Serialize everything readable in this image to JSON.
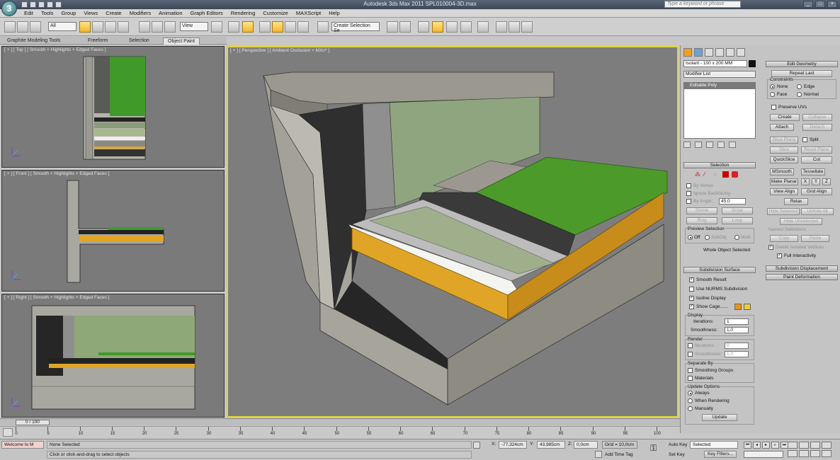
{
  "window": {
    "title": "Autodesk 3ds Max  2011     SPL010004-3D.max",
    "search_placeholder": "Type a keyword or phrase",
    "app_logo_letter": "3"
  },
  "menu": [
    "Edit",
    "Tools",
    "Group",
    "Views",
    "Create",
    "Modifiers",
    "Animation",
    "Graph Editors",
    "Rendering",
    "Customize",
    "MAXScript",
    "Help"
  ],
  "toolbar": {
    "selection_filter": "All",
    "ref_coord": "View",
    "named_selection_placeholder": "Create Selection Se"
  },
  "ribbon": {
    "tabs": [
      "Graphite Modeling Tools",
      "Freeform",
      "Selection",
      "Object Paint"
    ],
    "active_tab": "Object Paint"
  },
  "viewports": {
    "top": "[ + ] [ Top ] [ Smooth + Highlights + Edged Faces ]",
    "front": "[ + ] [ Front ] [ Smooth + Highlights + Edged Faces ]",
    "right": "[ + ] [ Right ] [ Smooth + Highlights + Edged Faces ]",
    "perspective": "[ + ] [ Perspective ] [ Ambient Occlusion + MXn* ]"
  },
  "command_panel": {
    "object_name": "Isolant - 100 x 200 MM",
    "modifier_list": "Modifier List",
    "stack_item": "Editable Poly",
    "edit_geometry": {
      "title": "Edit Geometry",
      "repeat_last": "Repeat Last",
      "constraints": "Constraints",
      "none": "None",
      "edge": "Edge",
      "face": "Face",
      "normal": "Normal",
      "preserve_uvs": "Preserve UVs",
      "create": "Create",
      "collapse": "Collapse",
      "attach": "Attach",
      "detach": "Detach",
      "slice_plane": "Slice Plane",
      "split": "Split",
      "slice": "Slice",
      "reset_plane": "Reset Plane",
      "quickslice": "QuickSlice",
      "cut": "Cut",
      "msmooth": "MSmooth",
      "tessellate": "Tessellate",
      "make_planar": "Make Planar",
      "x": "X",
      "y": "Y",
      "z": "Z",
      "view_align": "View Align",
      "grid_align": "Grid Align",
      "relax": "Relax",
      "hide_selected": "Hide Selected",
      "unhide_all": "Unhide All",
      "hide_unselected": "Hide Unselected",
      "named_selections": "Named Selections:",
      "copy": "Copy",
      "paste": "Paste",
      "delete_isolated": "Delete Isolated Vertices",
      "full_interactivity": "Full Interactivity"
    },
    "selection": {
      "title": "Selection",
      "by_vertex": "By Vertex",
      "ignore_backfacing": "Ignore Backfacing",
      "by_angle": "By Angle:",
      "angle_value": "45,0",
      "shrink": "Shrink",
      "grow": "Grow",
      "ring": "Ring",
      "loop": "Loop",
      "preview_selection": "Preview Selection",
      "off": "Off",
      "subobj": "SubObj",
      "multi": "Multi",
      "whole_object": "Whole Object Selected"
    },
    "subdivision": {
      "title": "Subdivision Surface",
      "smooth_result": "Smooth Result",
      "use_nurms": "Use NURMS Subdivision",
      "isoline_display": "Isoline Display",
      "show_cage": "Show Cage......",
      "display": "Display",
      "iterations_label": "Iterations:",
      "iterations": "1",
      "smoothness_label": "Smoothness:",
      "smoothness": "1,0",
      "render": "Render",
      "render_iterations": "0",
      "render_smoothness": "1,0",
      "separate_by": "Separate By",
      "smoothing_groups": "Smoothing Groups",
      "materials": "Materials",
      "update_options": "Update Options",
      "always": "Always",
      "when_rendering": "When Rendering",
      "manually": "Manually",
      "update": "Update"
    },
    "subdivision_displacement": "Subdivision Displacement",
    "paint_deformation": "Paint Deformation",
    "cage_colors": [
      "#e8931a",
      "#e8cf3a"
    ]
  },
  "timeline": {
    "frame_display": "0 / 100",
    "ticks": [
      "0",
      "5",
      "10",
      "15",
      "20",
      "25",
      "30",
      "35",
      "40",
      "45",
      "50",
      "55",
      "60",
      "65",
      "70",
      "75",
      "80",
      "85",
      "90",
      "95",
      "100"
    ]
  },
  "status": {
    "maxscript": "Welcome to M",
    "selection_status": "None Selected",
    "prompt": "Click or click-and-drag to select objects",
    "x_label": "X:",
    "x": "-77,324cm",
    "y_label": "Y:",
    "y": "43,985cm",
    "z_label": "Z:",
    "z": "0,0cm",
    "grid": "Grid = 10,0cm",
    "add_time_tag": "Add Time Tag",
    "auto_key": "Auto Key",
    "set_key": "Set Key",
    "selected": "Selected",
    "key_filters": "Key Filters..."
  },
  "colors": {
    "viewport_bg": "#7d7d7d",
    "active_border": "#e3d43a",
    "grass": "#4c9a2a",
    "insulation": "#e0a526",
    "concrete": "#a4a298",
    "brick": "#2e2e2e"
  }
}
